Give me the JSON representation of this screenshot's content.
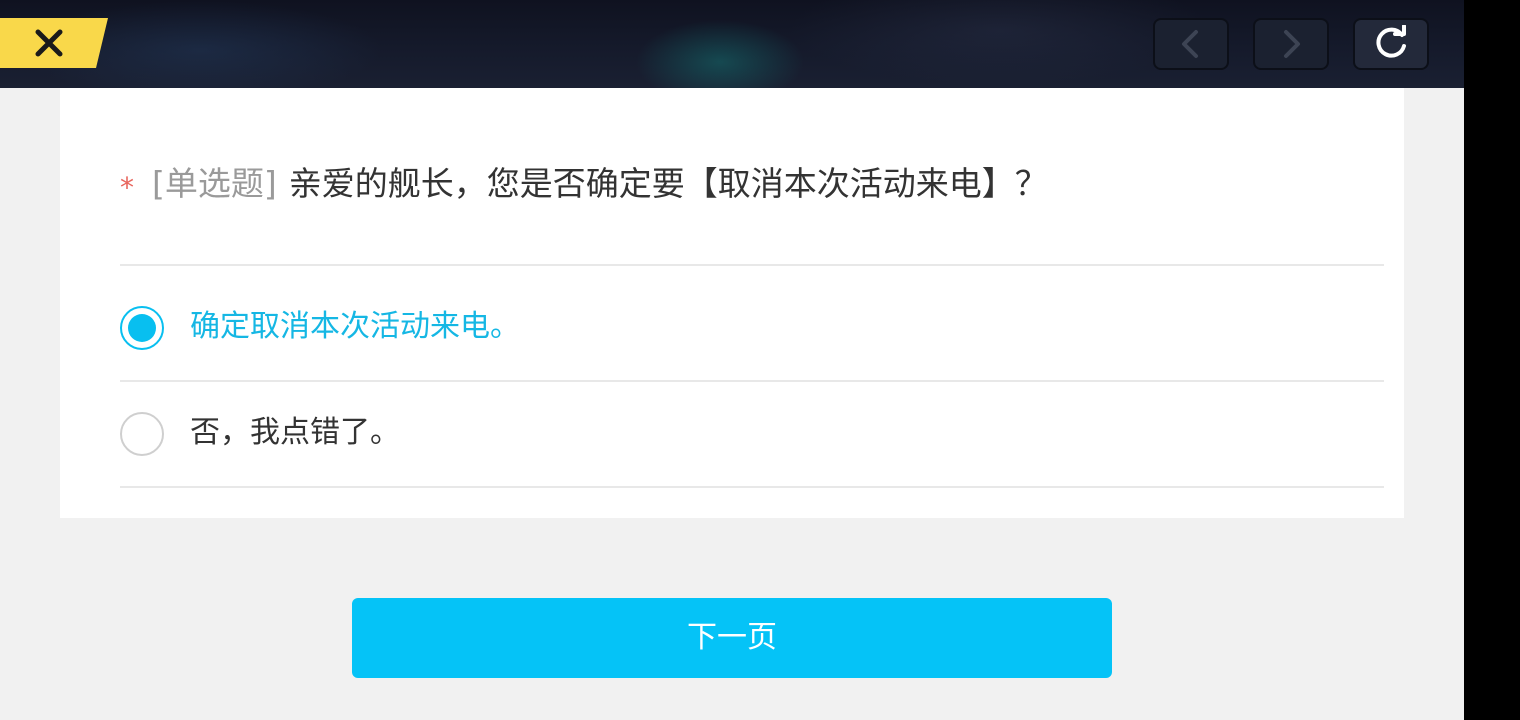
{
  "toolbar": {
    "close_icon": "close-icon",
    "back_icon": "chevron-left-icon",
    "forward_icon": "chevron-right-icon",
    "refresh_icon": "refresh-icon",
    "close_color": "#f9d84a"
  },
  "question": {
    "required_mark": "*",
    "type_label": "[单选题]",
    "text": "亲爱的舰长，您是否确定要【取消本次活动来电】？"
  },
  "options": [
    {
      "label": "确定取消本次活动来电。",
      "selected": true
    },
    {
      "label": "否，我点错了。",
      "selected": false
    }
  ],
  "next_button": {
    "label": "下一页"
  },
  "colors": {
    "accent": "#05c3f7",
    "selected_text": "#15b7e4",
    "required": "#e8665e",
    "page_bg": "#f1f1f1"
  }
}
